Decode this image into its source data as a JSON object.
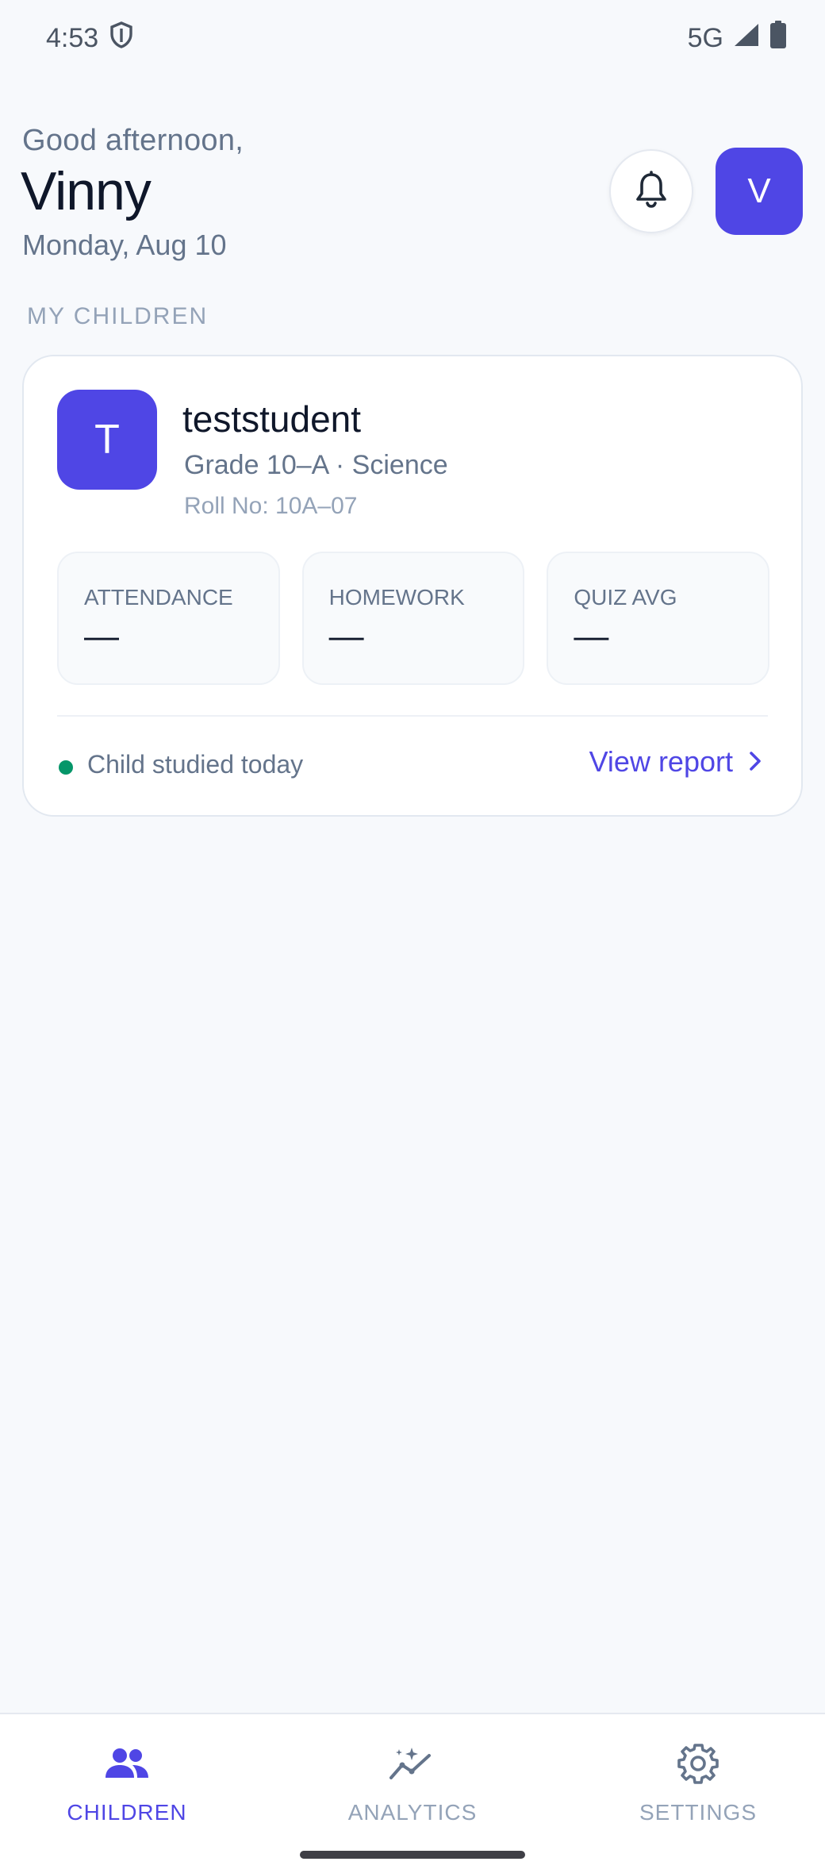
{
  "status_bar": {
    "time": "4:53",
    "network": "5G"
  },
  "header": {
    "greeting": "Good afternoon,",
    "name": "Vinny",
    "date": "Monday, Aug 10",
    "avatar_initial": "V"
  },
  "section": {
    "label": "MY CHILDREN"
  },
  "child": {
    "initial": "T",
    "name": "teststudent",
    "grade": "Grade 10–A · Science",
    "roll": "Roll No: 10A–07",
    "stats": [
      {
        "label": "ATTENDANCE",
        "value": "—"
      },
      {
        "label": "HOMEWORK",
        "value": "—"
      },
      {
        "label": "QUIZ AVG",
        "value": "—"
      }
    ],
    "status_text": "Child studied today",
    "view_report_label": "View report"
  },
  "nav": {
    "items": [
      {
        "label": "CHILDREN",
        "icon": "people-icon",
        "active": true
      },
      {
        "label": "ANALYTICS",
        "icon": "sparkle-chart-icon",
        "active": false
      },
      {
        "label": "SETTINGS",
        "icon": "gear-icon",
        "active": false
      }
    ]
  },
  "colors": {
    "accent": "#4f46e5",
    "status_green": "#059669",
    "background": "#f7f9fc"
  }
}
